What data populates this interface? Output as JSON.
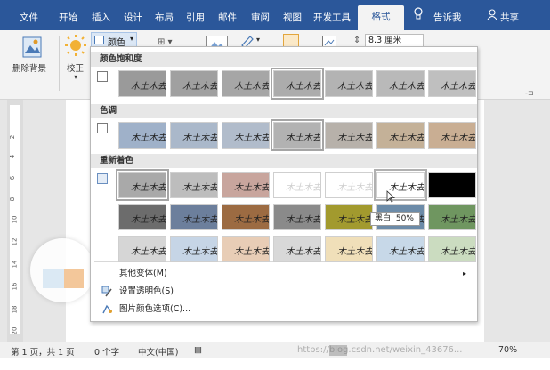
{
  "tabs": {
    "file": "文件",
    "home": "开始",
    "insert": "插入",
    "design": "设计",
    "layout": "布局",
    "references": "引用",
    "mailings": "邮件",
    "review": "审阅",
    "view": "视图",
    "developer": "开发工具",
    "format": "格式",
    "tell": "告诉我",
    "share": "共享"
  },
  "ribbon": {
    "remove_bg": "删除背景",
    "corrections": "校正",
    "color": "颜色",
    "size_value": "8.3 厘米"
  },
  "panel": {
    "saturation_title": "颜色饱和度",
    "tone_title": "色调",
    "recolor_title": "重新着色",
    "more_variations": "其他变体(M)",
    "set_transparent": "设置透明色(S)",
    "color_options": "图片颜色选项(C)...",
    "tooltip": "黑白: 50%",
    "signature_text": "木土木去"
  },
  "colors": {
    "tabbar": "#2b579a",
    "saturation": [
      "#9a9a9a",
      "#a0a0a0",
      "#a6a6a6",
      "#acacac",
      "#b3b3b3",
      "#b9b9b9",
      "#bfbfbf"
    ],
    "tone": [
      "#9fb1c9",
      "#aab8ca",
      "#b1bccb",
      "#b2b2b2",
      "#b7b1aa",
      "#c4b198",
      "#c9ae93"
    ],
    "recolor_row1": [
      "#a9a9a9",
      "#bdbdbd",
      "#c8a59d",
      "#ffffff",
      "#ffffff",
      "#ffffff",
      "#000000"
    ],
    "recolor_row2": [
      "#6c6c6c",
      "#6c7f9c",
      "#9c6b42",
      "#8a8a8a",
      "#a29a2e",
      "#6c8ba8",
      "#6f9660"
    ],
    "recolor_row3": [
      "#d6d6d6",
      "#c6d5e6",
      "#e8cdb6",
      "#d8d8d8",
      "#f0dfb9",
      "#c7d8e8",
      "#cbdcc0"
    ]
  },
  "status": {
    "page": "第 1 页，共 1 页",
    "words": "0 个字",
    "lang": "中文(中国)",
    "zoom": "70%"
  },
  "watermark": "https://blog.csdn.net/weixin_43676..."
}
